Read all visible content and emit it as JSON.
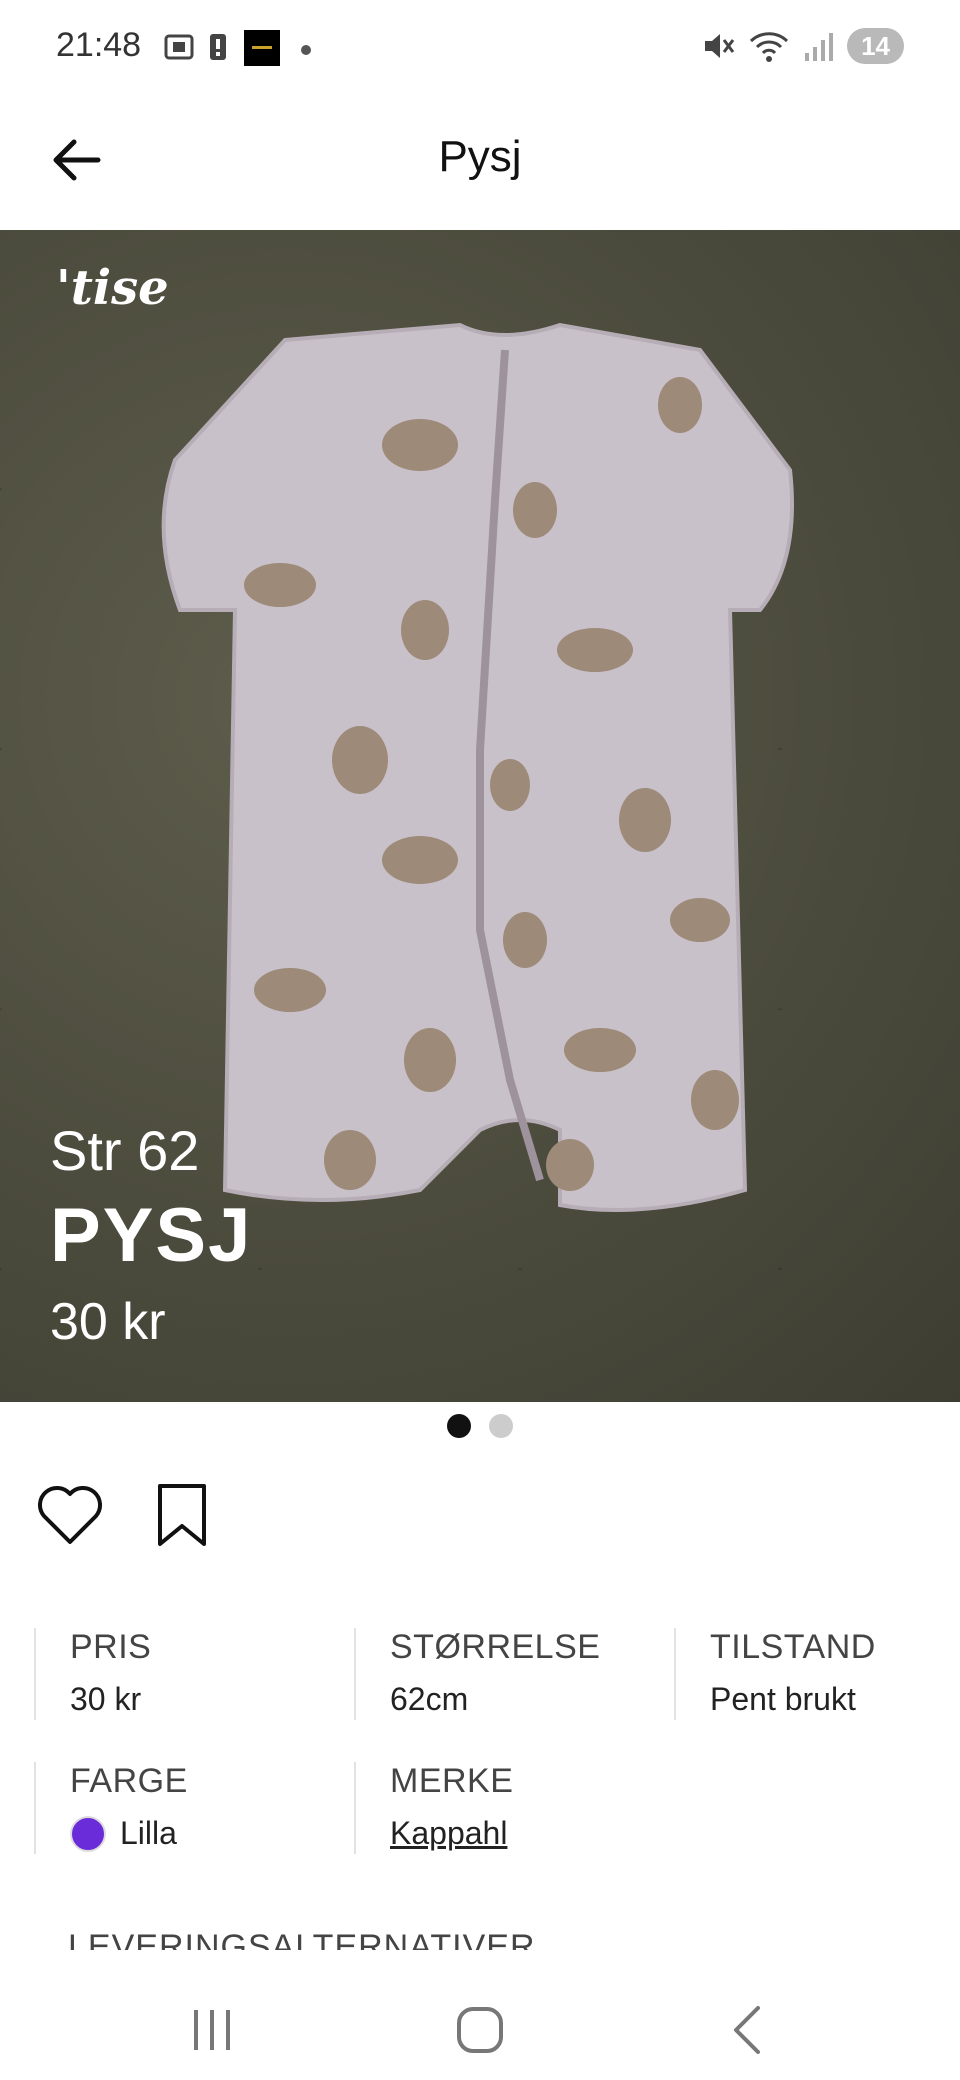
{
  "status_bar": {
    "time": "21:48",
    "battery": "14"
  },
  "header": {
    "title": "Pysj"
  },
  "hero": {
    "brand": "'tise",
    "caption_size": "Str 62",
    "caption_name": "PYSJ",
    "caption_price": "30 kr"
  },
  "pager": {
    "count": 2,
    "active_index": 0
  },
  "details": {
    "price": {
      "label": "PRIS",
      "value": "30 kr"
    },
    "size": {
      "label": "STØRRELSE",
      "value": "62cm"
    },
    "condition": {
      "label": "TILSTAND",
      "value": "Pent brukt"
    },
    "color": {
      "label": "FARGE",
      "value": "Lilla",
      "swatch": "#6a2bd9"
    },
    "brand": {
      "label": "MERKE",
      "value": "Kappahl"
    }
  },
  "delivery_section": {
    "label": "LEVERINGSALTERNATIVER"
  },
  "icons": {
    "back": "arrow-left-icon",
    "like": "heart-icon",
    "save": "bookmark-icon"
  }
}
